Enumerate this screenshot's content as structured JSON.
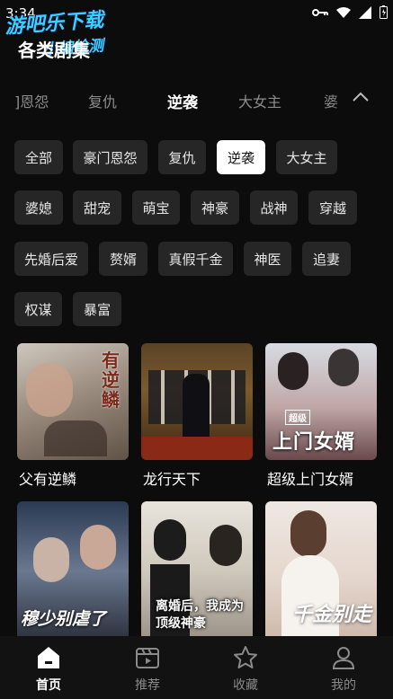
{
  "status": {
    "time": "3:34"
  },
  "watermark": {
    "line1": "游吧乐下载",
    "line2": "小编检测"
  },
  "page": {
    "title": "各类剧集"
  },
  "tabs": [
    {
      "label": "]恩怨"
    },
    {
      "label": "复仇"
    },
    {
      "label": "逆袭"
    },
    {
      "label": "大女主"
    },
    {
      "label": "婆"
    }
  ],
  "filters": [
    "全部",
    "豪门恩怨",
    "复仇",
    "逆袭",
    "大女主",
    "婆媳",
    "甜宠",
    "萌宝",
    "神豪",
    "战神",
    "穿越",
    "先婚后爱",
    "赘婿",
    "真假千金",
    "神医",
    "追妻",
    "权谋",
    "暴富"
  ],
  "selected_filter": "逆袭",
  "dramas": [
    {
      "title": "父有逆鳞",
      "cover_text": "有逆鳞"
    },
    {
      "title": "龙行天下",
      "cover_text": ""
    },
    {
      "title": "超级上门女婿",
      "cover_text": "上门女婿",
      "cover_tag": "超级"
    },
    {
      "title": "",
      "cover_text": "穆少别虐了"
    },
    {
      "title": "",
      "cover_text": "离婚后，我成为顶级神豪"
    },
    {
      "title": "",
      "cover_text": "千金别走"
    }
  ],
  "tabbar": [
    {
      "label": "首页",
      "icon": "home-icon",
      "active": true
    },
    {
      "label": "推荐",
      "icon": "video-icon",
      "active": false
    },
    {
      "label": "收藏",
      "icon": "star-icon",
      "active": false
    },
    {
      "label": "我的",
      "icon": "user-icon",
      "active": false
    }
  ],
  "colors": {
    "background": "#0c0c0c",
    "chip": "#262626",
    "chip_active": "#ffffff",
    "watermark": "#3ad0ff"
  }
}
